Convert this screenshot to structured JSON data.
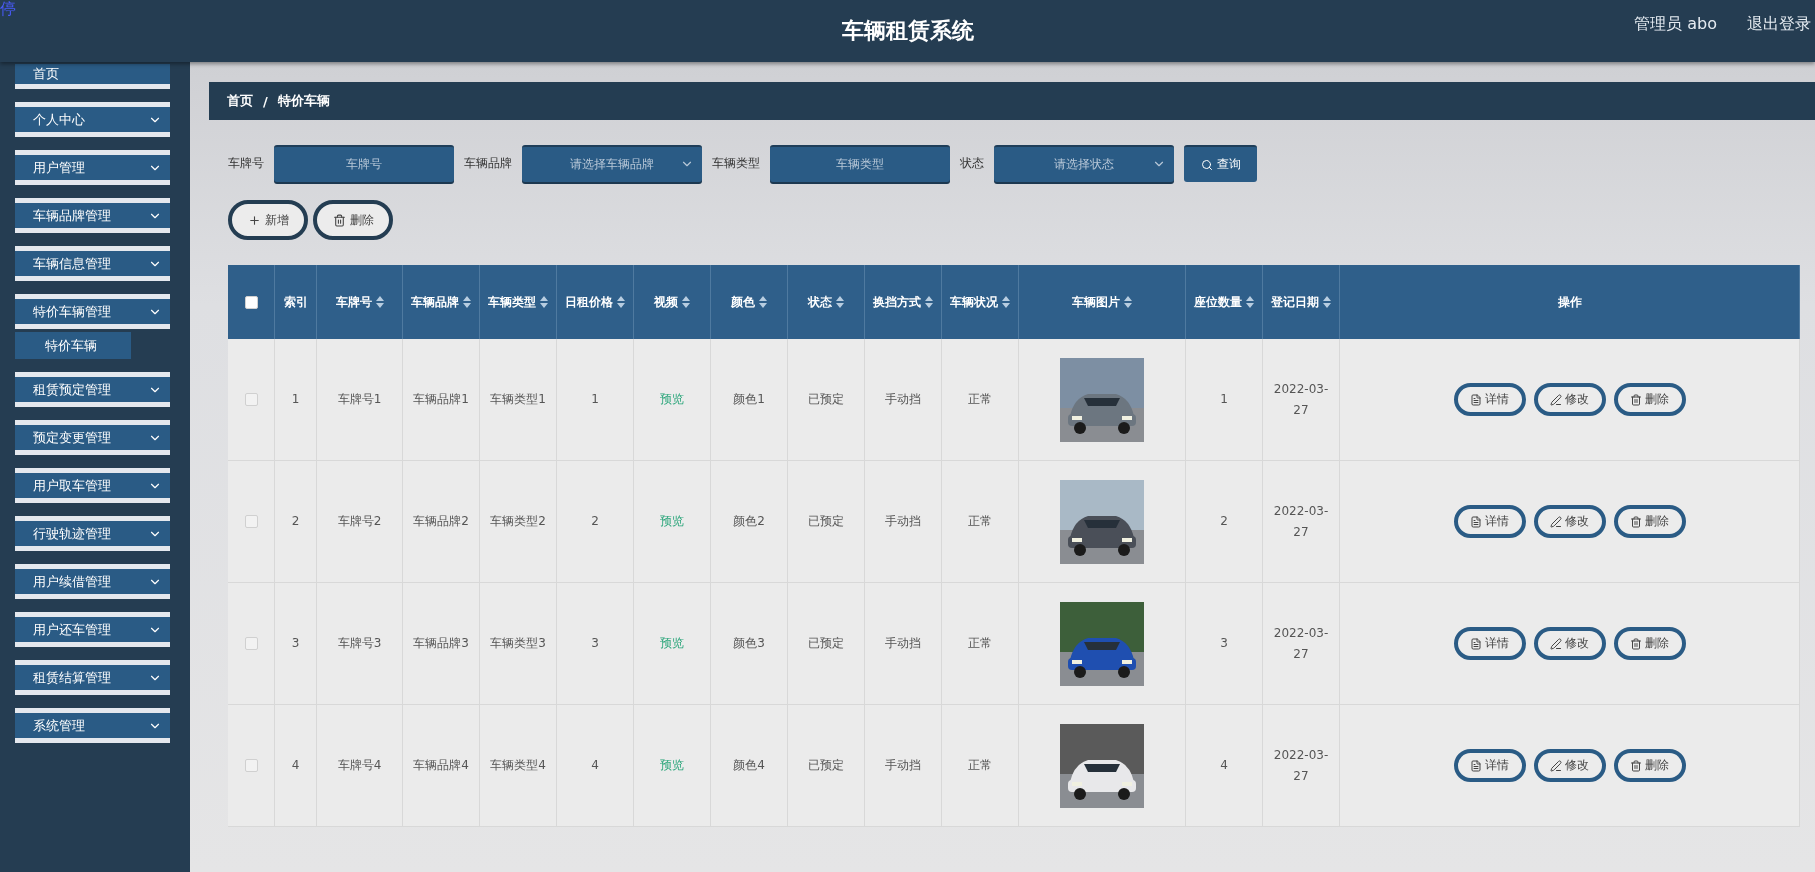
{
  "corner_mark": "停",
  "header": {
    "title": "车辆租赁系统",
    "user": "管理员 abo",
    "logout": "退出登录"
  },
  "sidebar": {
    "items": [
      {
        "label": "首页",
        "kind": "link"
      },
      {
        "label": "个人中心",
        "kind": "menu"
      },
      {
        "label": "用户管理",
        "kind": "menu"
      },
      {
        "label": "车辆品牌管理",
        "kind": "menu"
      },
      {
        "label": "车辆信息管理",
        "kind": "menu"
      },
      {
        "label": "特价车辆管理",
        "kind": "menu",
        "children": [
          {
            "label": "特价车辆"
          }
        ]
      },
      {
        "label": "租赁预定管理",
        "kind": "menu"
      },
      {
        "label": "预定变更管理",
        "kind": "menu"
      },
      {
        "label": "用户取车管理",
        "kind": "menu"
      },
      {
        "label": "行驶轨迹管理",
        "kind": "menu"
      },
      {
        "label": "用户续借管理",
        "kind": "menu"
      },
      {
        "label": "用户还车管理",
        "kind": "menu"
      },
      {
        "label": "租赁结算管理",
        "kind": "menu"
      },
      {
        "label": "系统管理",
        "kind": "menu"
      }
    ]
  },
  "breadcrumb": {
    "items": [
      "首页",
      "特价车辆"
    ],
    "separator": "/"
  },
  "filters": [
    {
      "label": "车牌号",
      "kind": "input",
      "placeholder": "车牌号"
    },
    {
      "label": "车辆品牌",
      "kind": "select",
      "placeholder": "请选择车辆品牌"
    },
    {
      "label": "车辆类型",
      "kind": "input",
      "placeholder": "车辆类型"
    },
    {
      "label": "状态",
      "kind": "select",
      "placeholder": "请选择状态"
    }
  ],
  "search_button": "查询",
  "actions": [
    {
      "label": "新增",
      "kind": "add"
    },
    {
      "label": "删除",
      "kind": "delete"
    }
  ],
  "table": {
    "select_all_checked": false,
    "columns": [
      {
        "label": "索引",
        "sortable": false
      },
      {
        "label": "车牌号",
        "sortable": true
      },
      {
        "label": "车辆品牌",
        "sortable": true
      },
      {
        "label": "车辆类型",
        "sortable": true
      },
      {
        "label": "日租价格",
        "sortable": true
      },
      {
        "label": "视频",
        "sortable": true
      },
      {
        "label": "颜色",
        "sortable": true
      },
      {
        "label": "状态",
        "sortable": true
      },
      {
        "label": "换挡方式",
        "sortable": true
      },
      {
        "label": "车辆状况",
        "sortable": true
      },
      {
        "label": "车辆图片",
        "sortable": true
      },
      {
        "label": "座位数量",
        "sortable": true
      },
      {
        "label": "登记日期",
        "sortable": true
      },
      {
        "label": "操作",
        "sortable": false
      }
    ],
    "rows": [
      {
        "checked": false,
        "cells": [
          "1",
          "车牌号1",
          "车辆品牌1",
          "车辆类型1",
          "1",
          "预览",
          "颜色1",
          "已预定",
          "手动挡",
          "正常",
          null,
          "1",
          "2022-03-27"
        ],
        "photo": {
          "kind": "picture"
        },
        "buttons": [
          {
            "label": "详情",
            "kind": "detail"
          },
          {
            "label": "修改",
            "kind": "edit"
          },
          {
            "label": "删除",
            "kind": "delete"
          }
        ]
      },
      {
        "checked": false,
        "cells": [
          "2",
          "车牌号2",
          "车辆品牌2",
          "车辆类型2",
          "2",
          "预览",
          "颜色2",
          "已预定",
          "手动挡",
          "正常",
          null,
          "2",
          "2022-03-27"
        ],
        "photo": {
          "kind": "picture"
        },
        "buttons": [
          {
            "label": "详情",
            "kind": "detail"
          },
          {
            "label": "修改",
            "kind": "edit"
          },
          {
            "label": "删除",
            "kind": "delete"
          }
        ]
      },
      {
        "checked": false,
        "cells": [
          "3",
          "车牌号3",
          "车辆品牌3",
          "车辆类型3",
          "3",
          "预览",
          "颜色3",
          "已预定",
          "手动挡",
          "正常",
          null,
          "3",
          "2022-03-27"
        ],
        "photo": {
          "kind": "picture"
        },
        "buttons": [
          {
            "label": "详情",
            "kind": "detail"
          },
          {
            "label": "修改",
            "kind": "edit"
          },
          {
            "label": "删除",
            "kind": "delete"
          }
        ]
      },
      {
        "checked": false,
        "cells": [
          "4",
          "车牌号4",
          "车辆品牌4",
          "车辆类型4",
          "4",
          "预览",
          "颜色4",
          "已预定",
          "手动挡",
          "正常",
          null,
          "4",
          "2022-03-27"
        ],
        "photo": {
          "kind": "picture"
        },
        "buttons": [
          {
            "label": "详情",
            "kind": "detail"
          },
          {
            "label": "修改",
            "kind": "edit"
          },
          {
            "label": "删除",
            "kind": "delete"
          }
        ]
      }
    ]
  }
}
